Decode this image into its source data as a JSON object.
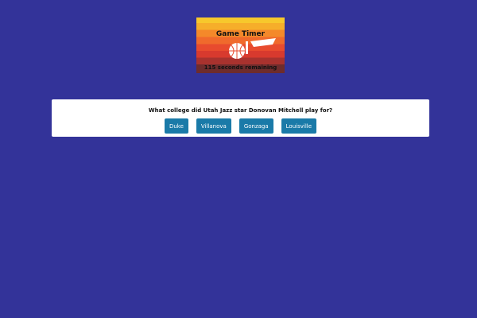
{
  "timer": {
    "title": "Game Timer",
    "remaining": "115 seconds remaining",
    "logo_icon": "basketball-note-logo-icon",
    "colors": [
      "#f7c82c",
      "#f6ae2a",
      "#f4892a",
      "#f06a2c",
      "#e84b2e",
      "#d83a2e",
      "#a8322e",
      "#6e2c2c"
    ]
  },
  "quiz": {
    "question": "What college did Utah Jazz star Donovan Mitchell play for?",
    "answers": [
      {
        "label": "Duke"
      },
      {
        "label": "Villanova"
      },
      {
        "label": "Gonzaga"
      },
      {
        "label": "Louisville"
      }
    ]
  },
  "colors": {
    "background": "#333399",
    "card": "#ffffff",
    "button": "#1a7aa8"
  }
}
